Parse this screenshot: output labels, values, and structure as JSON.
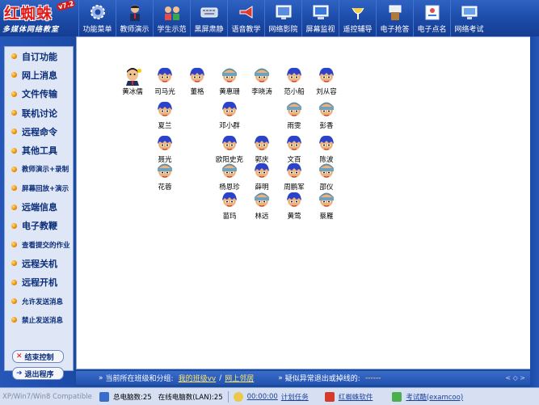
{
  "logo": {
    "title": "红蜘蛛",
    "version": "v7.2",
    "subtitle": "多媒体网络教室"
  },
  "toolbar": [
    {
      "label": "功能菜单",
      "icon": "gear-icon"
    },
    {
      "label": "教师演示",
      "icon": "teacher-icon"
    },
    {
      "label": "学生示范",
      "icon": "students-icon"
    },
    {
      "label": "黑屏肃静",
      "icon": "keyboard-icon"
    },
    {
      "label": "语音教学",
      "icon": "megaphone-icon"
    },
    {
      "label": "网络影院",
      "icon": "cinema-icon"
    },
    {
      "label": "屏幕监视",
      "icon": "monitor-icon"
    },
    {
      "label": "遥控辅导",
      "icon": "satellite-icon"
    },
    {
      "label": "电子抢答",
      "icon": "podium-icon"
    },
    {
      "label": "电子点名",
      "icon": "rollcall-icon"
    },
    {
      "label": "网络考试",
      "icon": "exam-icon"
    }
  ],
  "sidebar": {
    "items": [
      {
        "label": "自订功能",
        "small": false
      },
      {
        "label": "网上消息",
        "small": false
      },
      {
        "label": "文件传输",
        "small": false
      },
      {
        "label": "联机讨论",
        "small": false
      },
      {
        "label": "远程命令",
        "small": false
      },
      {
        "label": "其他工具",
        "small": false
      },
      {
        "label": "教师演示+录制",
        "small": true
      },
      {
        "label": "屏幕回放+演示",
        "small": true
      },
      {
        "label": "远端信息",
        "small": false
      },
      {
        "label": "电子教鞭",
        "small": false
      },
      {
        "label": "查看提交的作业",
        "small": true
      },
      {
        "label": "远程关机",
        "small": false
      },
      {
        "label": "远程开机",
        "small": false
      },
      {
        "label": "允许发送消息",
        "small": true
      },
      {
        "label": "禁止发送消息",
        "small": true
      }
    ],
    "buttons": {
      "end_control": "结束控制",
      "exit": "退出程序"
    }
  },
  "seats": [
    {
      "name": "黄冰儒",
      "type": "teacher"
    },
    {
      "name": "司马光",
      "type": "student"
    },
    {
      "name": "董格",
      "type": "student"
    },
    {
      "name": "黄惠珊",
      "type": "student-hat"
    },
    {
      "name": "李晓涛",
      "type": "student-hat"
    },
    {
      "name": "范小船",
      "type": "student"
    },
    {
      "name": "刘从容",
      "type": "student"
    },
    {
      "name": "夏兰",
      "type": "student"
    },
    {
      "name": "邓小群",
      "type": "student"
    },
    {
      "name": "雨雯",
      "type": "student-hat"
    },
    {
      "name": "彭香",
      "type": "student-hat"
    },
    {
      "name": "聂光",
      "type": "student"
    },
    {
      "name": "欧阳史克",
      "type": "student"
    },
    {
      "name": "郭庆",
      "type": "student"
    },
    {
      "name": "文百",
      "type": "student"
    },
    {
      "name": "陈波",
      "type": "student"
    },
    {
      "name": "花蓉",
      "type": "student-hat"
    },
    {
      "name": "杨恩珍",
      "type": "student-hat"
    },
    {
      "name": "薛明",
      "type": "student"
    },
    {
      "name": "周鹏军",
      "type": "student"
    },
    {
      "name": "邵仪",
      "type": "student-hat"
    },
    {
      "name": "苗玛",
      "type": "student"
    },
    {
      "name": "林远",
      "type": "student-hat"
    },
    {
      "name": "黄莺",
      "type": "student"
    },
    {
      "name": "蔡雁",
      "type": "student-hat"
    }
  ],
  "infobar": {
    "current_class_label": "当前所在班级和分组:",
    "class_name": "我的班级vv",
    "group_name": "网上邻居",
    "abnormal_label": "疑似异常退出或掉线的:",
    "abnormal_value": "------",
    "nav": "< ◇ >"
  },
  "statusbar": {
    "compat": "XP/Win7/Win8 Compatible",
    "total_label": "总电脑数:25",
    "online_label": "在线电脑数(LAN):25",
    "time": "00:00:00",
    "task": "计划任务",
    "brand": "红蜘蛛软件",
    "exam": "考试酷(examcoo)"
  },
  "colors": {
    "header": "#1b4aa7",
    "sidebar_text": "#0a2d7a",
    "link_yellow": "#ffe86a",
    "avatar_hair": "#2a43c9",
    "avatar_skin": "#f0b27a"
  }
}
